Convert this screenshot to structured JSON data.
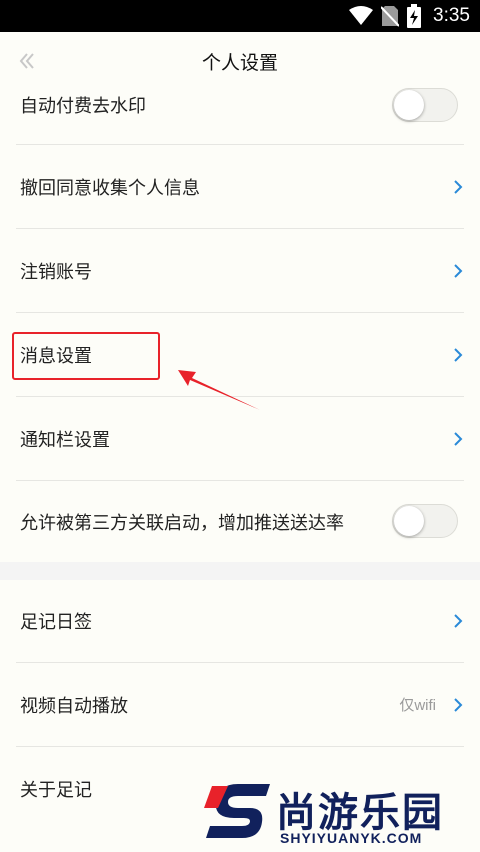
{
  "status_bar": {
    "time": "3:35",
    "icons": [
      "wifi-icon",
      "no-sim-icon",
      "battery-charging-icon"
    ]
  },
  "header": {
    "title": "个人设置",
    "back_icon": "double-chevron-left-icon"
  },
  "settings_group_1": [
    {
      "label": "自动付费去水印",
      "control": "toggle",
      "on": false
    },
    {
      "label": "撤回同意收集个人信息",
      "control": "chevron"
    },
    {
      "label": "注销账号",
      "control": "chevron"
    },
    {
      "label": "消息设置",
      "control": "chevron"
    },
    {
      "label": "通知栏设置",
      "control": "chevron"
    },
    {
      "label": "允许被第三方关联启动，增加推送送达率",
      "control": "toggle",
      "on": false
    }
  ],
  "settings_group_2": [
    {
      "label": "足记日签",
      "control": "chevron"
    },
    {
      "label": "视频自动播放",
      "control": "chevron",
      "value": "仅wifi"
    },
    {
      "label": "关于足记",
      "control": "none"
    }
  ],
  "watermark": {
    "title": "尚游乐园",
    "subtitle": "SHYIYUANYK.COM"
  },
  "colors": {
    "accent": "#2a8ad8",
    "highlight": "#e8222a",
    "background": "#fdfdf8",
    "separator": "#f4f4f4",
    "watermark": "#11215c"
  }
}
